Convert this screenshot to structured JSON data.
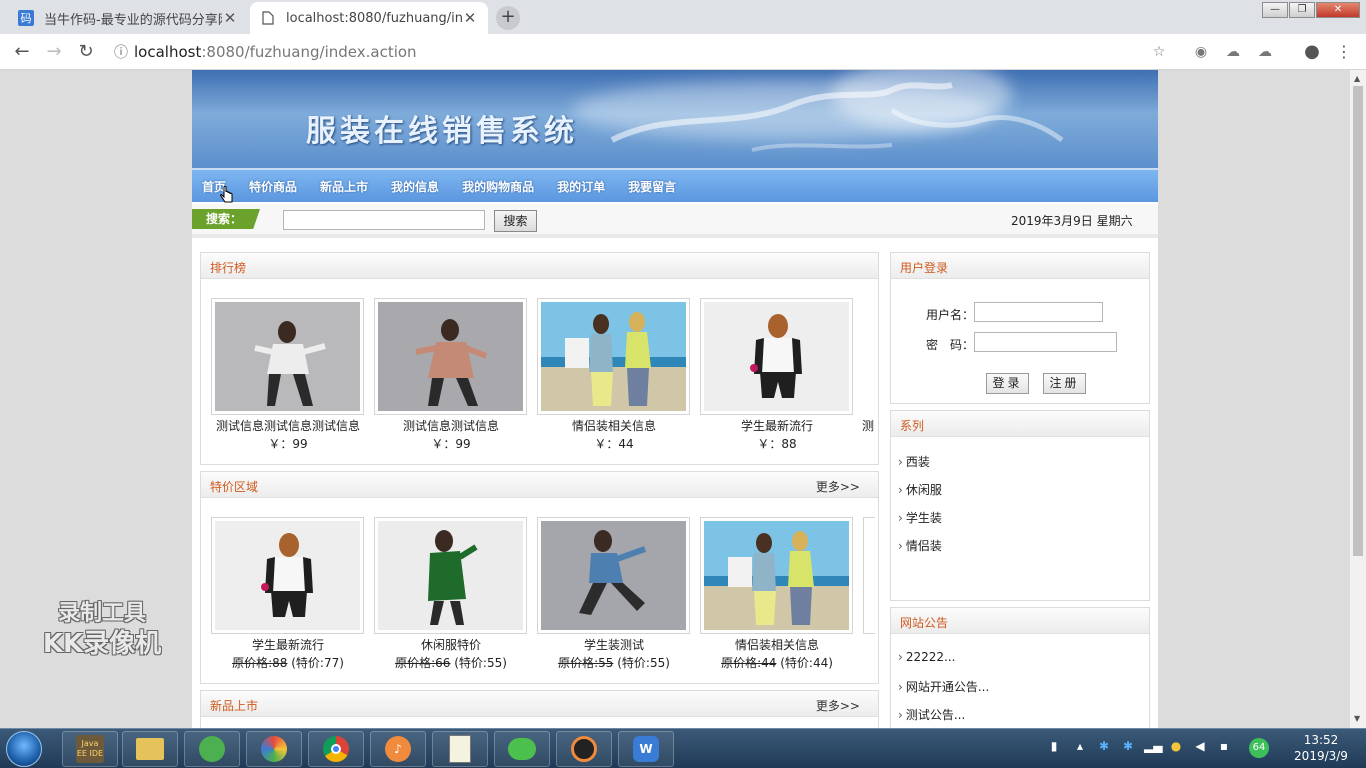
{
  "browser": {
    "tabs": [
      {
        "title": "当牛作码-最专业的源代码分享网",
        "favicon": "码"
      },
      {
        "title": "localhost:8080/fuzhuang/inde",
        "favicon": "page-icon"
      }
    ],
    "new_tab": "+",
    "address": {
      "host": "localhost",
      "path": ":8080/fuzhuang/index.action"
    },
    "window_controls": [
      "minimize",
      "restore",
      "close"
    ]
  },
  "site": {
    "banner_title": "服装在线销售系统",
    "nav": [
      "首页",
      "特价商品",
      "新品上市",
      "我的信息",
      "我的购物商品",
      "我的订单",
      "我要留言"
    ],
    "search": {
      "label": "搜索：",
      "button": "搜索",
      "value": ""
    },
    "date": "2019年3月9日 星期六",
    "ranking": {
      "title": "排行榜",
      "items": [
        {
          "name": "测试信息测试信息测试信息",
          "price": "￥：99"
        },
        {
          "name": "测试信息测试信息",
          "price": "￥：99"
        },
        {
          "name": "情侣装相关信息",
          "price": "￥：44"
        },
        {
          "name": "学生最新流行",
          "price": "￥：88"
        }
      ],
      "overflow_char": "测"
    },
    "special": {
      "title": "特价区域",
      "more": "更多>>",
      "items": [
        {
          "name": "学生最新流行",
          "orig_label": "原价格:",
          "orig": "88",
          "special": "(特价:77)"
        },
        {
          "name": "休闲服特价",
          "orig_label": "原价格:",
          "orig": "66",
          "special": "(特价:55)"
        },
        {
          "name": "学生装测试",
          "orig_label": "原价格:",
          "orig": "55",
          "special": "(特价:55)"
        },
        {
          "name": "情侣装相关信息",
          "orig_label": "原价格:",
          "orig": "44",
          "special": "(特价:44)"
        }
      ]
    },
    "new_arrivals": {
      "title": "新品上市",
      "more": "更多>>"
    },
    "login": {
      "title": "用户登录",
      "username_label": "用户名：",
      "password_label": "密　码：",
      "login_btn": "登录",
      "register_btn": "注册"
    },
    "series": {
      "title": "系列",
      "items": [
        "西装",
        "休闲服",
        "学生装",
        "情侣装"
      ]
    },
    "notice": {
      "title": "网站公告",
      "items": [
        "22222...",
        "网站开通公告...",
        "测试公告..."
      ]
    }
  },
  "watermark": {
    "line1": "录制工具",
    "line2": "KK录像机"
  },
  "taskbar": {
    "apps": [
      "Java EE IDE",
      "file-explorer",
      "green-app",
      "pinwheel-app",
      "chrome",
      "speaker-app",
      "notepad-app",
      "wechat",
      "ninja-app",
      "wps-app"
    ],
    "tray_badge": "64",
    "time": "13:52",
    "date": "2019/3/9"
  },
  "colors": {
    "panel_title": "#d05a1e",
    "nav_bg": "#5b97e0",
    "search_label_bg": "#6aa22b"
  }
}
